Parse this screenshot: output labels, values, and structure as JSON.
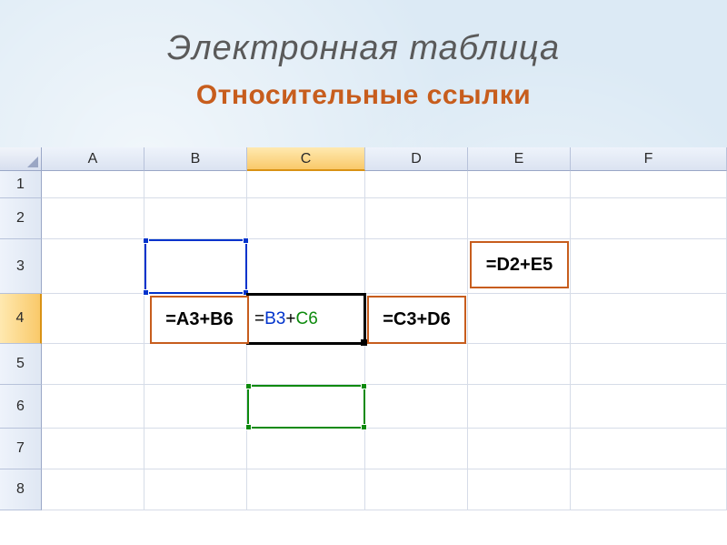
{
  "title": "Электронная таблица",
  "subtitle": "Относительные ссылки",
  "columns": [
    {
      "label": "A",
      "width": 113,
      "active": false
    },
    {
      "label": "B",
      "width": 113,
      "active": false
    },
    {
      "label": "C",
      "width": 130,
      "active": true
    },
    {
      "label": "D",
      "width": 113,
      "active": false
    },
    {
      "label": "E",
      "width": 113,
      "active": false
    },
    {
      "label": "F",
      "width": 172,
      "active": false
    }
  ],
  "rows": [
    {
      "label": "1",
      "height": 30,
      "active": false
    },
    {
      "label": "2",
      "height": 45,
      "active": false
    },
    {
      "label": "3",
      "height": 60,
      "active": false
    },
    {
      "label": "4",
      "height": 55,
      "active": true
    },
    {
      "label": "5",
      "height": 45,
      "active": false
    },
    {
      "label": "6",
      "height": 48,
      "active": false
    },
    {
      "label": "7",
      "height": 45,
      "active": false
    },
    {
      "label": "8",
      "height": 45,
      "active": false
    }
  ],
  "active_cell": {
    "ref": "C4",
    "eq": "=",
    "ref1": "B3",
    "plus": "+",
    "ref2": "C6"
  },
  "selections": {
    "blue": {
      "ref": "B3"
    },
    "green": {
      "ref": "C6"
    }
  },
  "formula_boxes": {
    "b4": "=A3+B6",
    "d4": "=C3+D6",
    "e3": "=D2+E5"
  }
}
